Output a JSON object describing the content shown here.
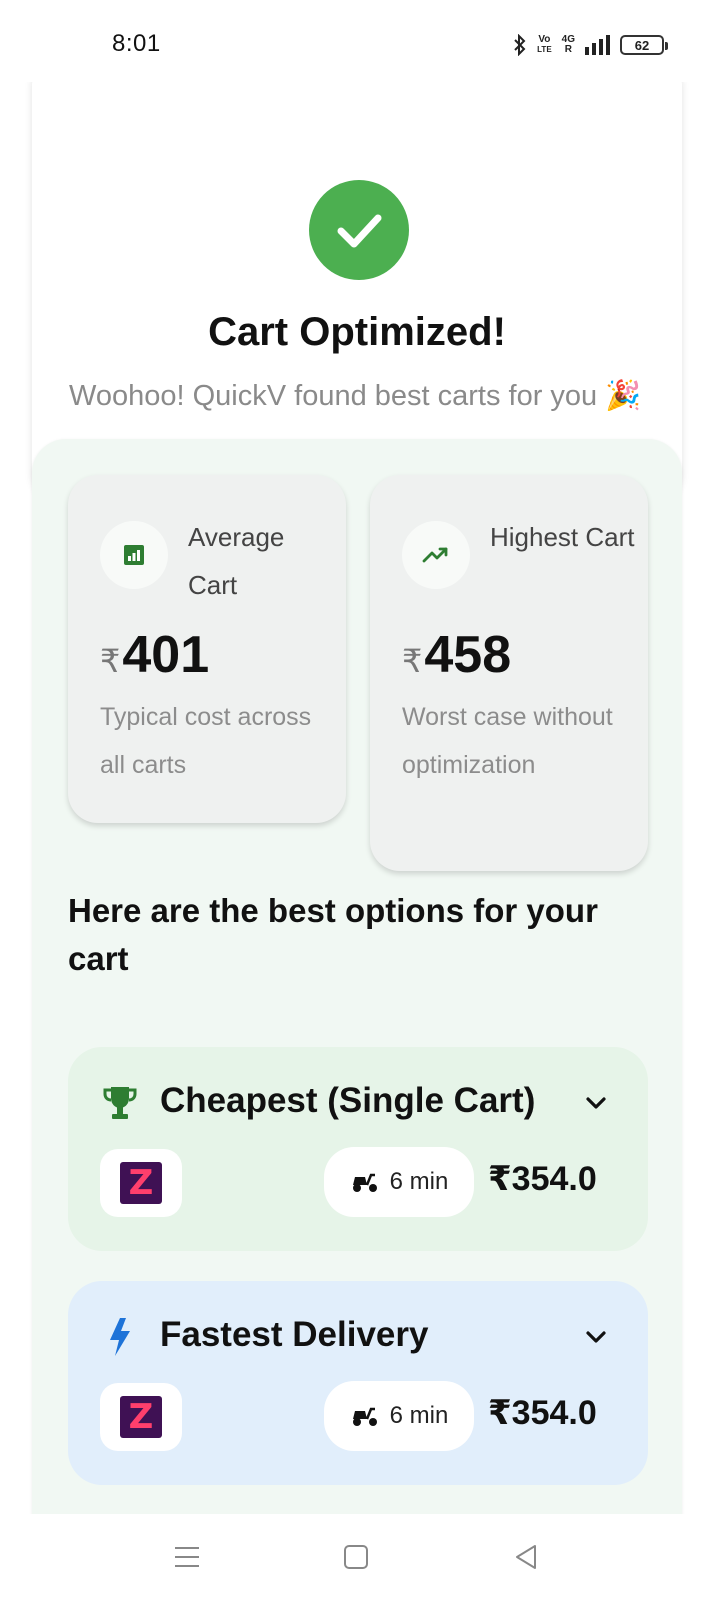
{
  "status_bar": {
    "time": "8:01",
    "volte_top": "Vo",
    "volte_bottom": "LTE",
    "network": "4G",
    "network_sub": "R",
    "battery": "62"
  },
  "success": {
    "title": "Cart Optimized!",
    "subtitle": "Woohoo! QuickV found best carts for you 🎉",
    "accent_color": "#4caf50"
  },
  "stats": {
    "average": {
      "label": "Average Cart",
      "currency": "₹",
      "amount": "401",
      "description": "Typical cost across all carts",
      "icon": "bar-chart-icon"
    },
    "highest": {
      "label": "Highest Cart",
      "currency": "₹",
      "amount": "458",
      "description": "Worst case without optimization",
      "icon": "trending-up-icon"
    }
  },
  "options_heading": "Here are the best options for your cart",
  "options": [
    {
      "title": "Cheapest (Single Cart)",
      "icon": "trophy-icon",
      "store_logo": "Z",
      "delivery_time": "6 min",
      "price": "₹354.0",
      "bg_color": "#e6f4e8"
    },
    {
      "title": "Fastest Delivery",
      "icon": "lightning-icon",
      "store_logo": "Z",
      "delivery_time": "6 min",
      "price": "₹354.0",
      "bg_color": "#e1eefb"
    }
  ]
}
